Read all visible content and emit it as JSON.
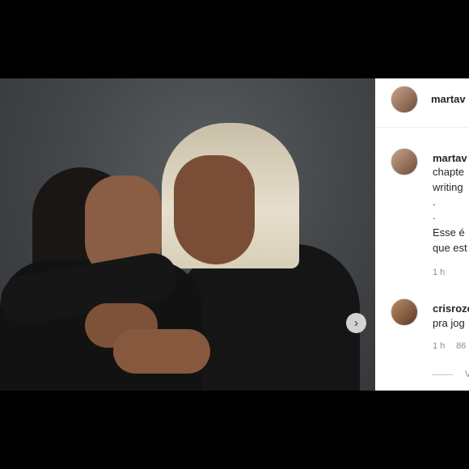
{
  "post": {
    "author": "martav",
    "caption_lines": [
      "chapte",
      "writing",
      ".",
      ".",
      "Esse é",
      "que est"
    ],
    "time": "1 h"
  },
  "comment": {
    "author": "crisroze",
    "text": "pra jog",
    "time": "1 h",
    "likes": "86",
    "view_replies": "V"
  },
  "colors": {
    "panel_bg": "#ffffff",
    "text": "#262626",
    "meta": "#8e8e8e"
  },
  "icons": {
    "carousel_next": "chevron-right-icon"
  }
}
